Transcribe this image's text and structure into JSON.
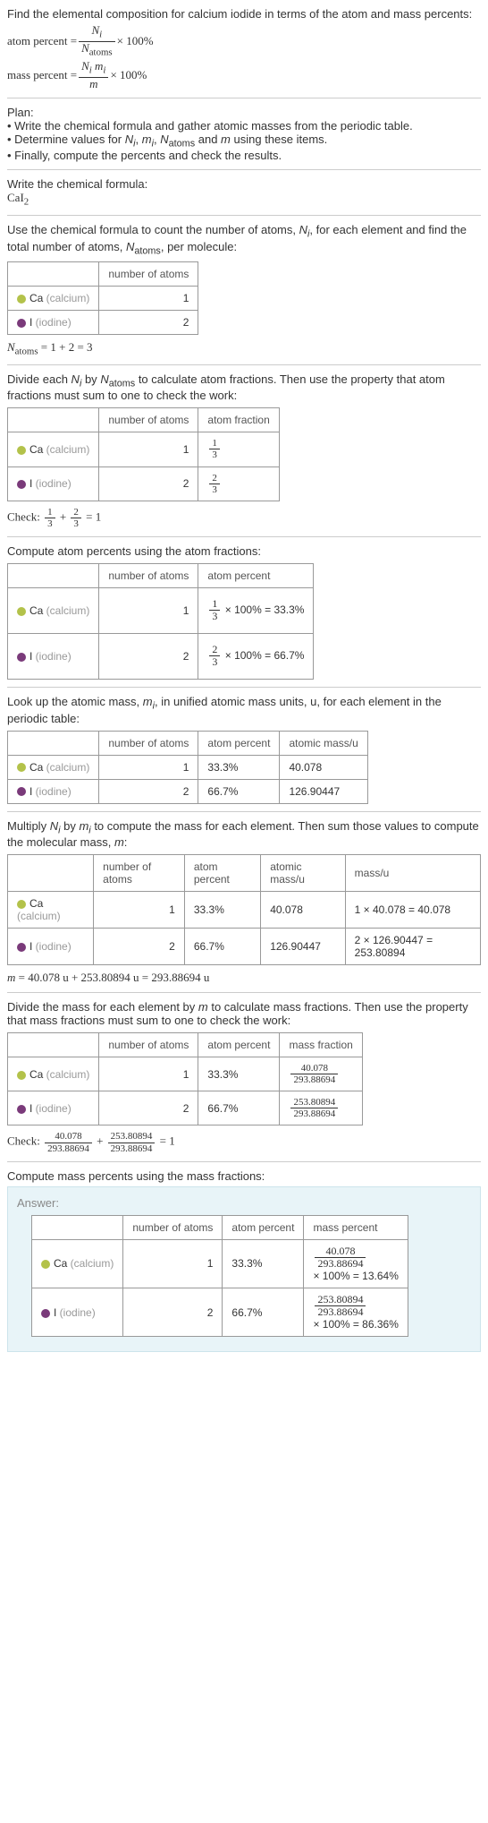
{
  "intro": {
    "line1": "Find the elemental composition for calcium iodide in terms of the atom and mass percents:",
    "atom_label": "atom percent =",
    "atom_frac_num": "N_i",
    "atom_frac_den": "N_atoms",
    "times100": "× 100%",
    "mass_label": "mass percent =",
    "mass_frac_num": "N_i m_i",
    "mass_frac_den": "m"
  },
  "plan": {
    "title": "Plan:",
    "b1": "• Write the chemical formula and gather atomic masses from the periodic table.",
    "b2_a": "• Determine values for ",
    "b2_b": " using these items.",
    "b2_vars": "N_i, m_i, N_atoms and m",
    "b3": "• Finally, compute the percents and check the results."
  },
  "formula": {
    "title": "Write the chemical formula:",
    "text": "CaI",
    "sub": "2"
  },
  "count": {
    "desc_a": "Use the chemical formula to count the number of atoms, ",
    "desc_b": ", for each element and find the total number of atoms, ",
    "desc_c": ", per molecule:",
    "ni": "N_i",
    "natoms": "N_atoms",
    "h_num": "number of atoms",
    "ca_label": "Ca",
    "ca_gray": " (calcium)",
    "ca_n": "1",
    "i_label": "I",
    "i_gray": " (iodine)",
    "i_n": "2",
    "result": "N_atoms = 1 + 2 = 3"
  },
  "atomfrac": {
    "desc": "Divide each N_i by N_atoms to calculate atom fractions. Then use the property that atom fractions must sum to one to check the work:",
    "h_num": "number of atoms",
    "h_frac": "atom fraction",
    "ca_n": "1",
    "ca_f_num": "1",
    "ca_f_den": "3",
    "i_n": "2",
    "i_f_num": "2",
    "i_f_den": "3",
    "check_label": "Check: ",
    "check_eq": " = 1"
  },
  "atompct": {
    "desc": "Compute atom percents using the atom fractions:",
    "h_num": "number of atoms",
    "h_pct": "atom percent",
    "ca_n": "1",
    "ca_calc": " × 100% = 33.3%",
    "i_n": "2",
    "i_calc": " × 100% = 66.7%"
  },
  "atomicmass": {
    "desc_a": "Look up the atomic mass, ",
    "desc_b": ", in unified atomic mass units, u, for each element in the periodic table:",
    "mi": "m_i",
    "h_num": "number of atoms",
    "h_pct": "atom percent",
    "h_mass": "atomic mass/u",
    "ca_n": "1",
    "ca_pct": "33.3%",
    "ca_mass": "40.078",
    "i_n": "2",
    "i_pct": "66.7%",
    "i_mass": "126.90447"
  },
  "molmass": {
    "desc": "Multiply N_i by m_i to compute the mass for each element. Then sum those values to compute the molecular mass, m:",
    "h_num": "number of atoms",
    "h_pct": "atom percent",
    "h_amass": "atomic mass/u",
    "h_mass": "mass/u",
    "ca_n": "1",
    "ca_pct": "33.3%",
    "ca_amass": "40.078",
    "ca_mass": "1 × 40.078 = 40.078",
    "i_n": "2",
    "i_pct": "66.7%",
    "i_amass": "126.90447",
    "i_mass": "2 × 126.90447 = 253.80894",
    "result": "m = 40.078 u + 253.80894 u = 293.88694 u"
  },
  "massfrac": {
    "desc": "Divide the mass for each element by m to calculate mass fractions. Then use the property that mass fractions must sum to one to check the work:",
    "h_num": "number of atoms",
    "h_pct": "atom percent",
    "h_frac": "mass fraction",
    "ca_n": "1",
    "ca_pct": "33.3%",
    "ca_f_num": "40.078",
    "ca_f_den": "293.88694",
    "i_n": "2",
    "i_pct": "66.7%",
    "i_f_num": "253.80894",
    "i_f_den": "293.88694",
    "check_label": "Check: ",
    "check_eq": " = 1"
  },
  "masspct": {
    "desc": "Compute mass percents using the mass fractions:"
  },
  "answer": {
    "title": "Answer:",
    "h_num": "number of atoms",
    "h_apct": "atom percent",
    "h_mpct": "mass percent",
    "ca_n": "1",
    "ca_apct": "33.3%",
    "ca_m_num": "40.078",
    "ca_m_den": "293.88694",
    "ca_m_res": "× 100% = 13.64%",
    "i_n": "2",
    "i_apct": "66.7%",
    "i_m_num": "253.80894",
    "i_m_den": "293.88694",
    "i_m_res": "× 100% = 86.36%"
  },
  "chart_data": {
    "type": "table",
    "title": "Elemental composition of calcium iodide CaI2",
    "elements": [
      {
        "symbol": "Ca",
        "name": "calcium",
        "atoms": 1,
        "atom_percent": 33.3,
        "atomic_mass_u": 40.078,
        "mass_u": 40.078,
        "mass_fraction": 0.1364,
        "mass_percent": 13.64
      },
      {
        "symbol": "I",
        "name": "iodine",
        "atoms": 2,
        "atom_percent": 66.7,
        "atomic_mass_u": 126.90447,
        "mass_u": 253.80894,
        "mass_fraction": 0.8636,
        "mass_percent": 86.36
      }
    ],
    "totals": {
      "N_atoms": 3,
      "molecular_mass_u": 293.88694
    }
  }
}
